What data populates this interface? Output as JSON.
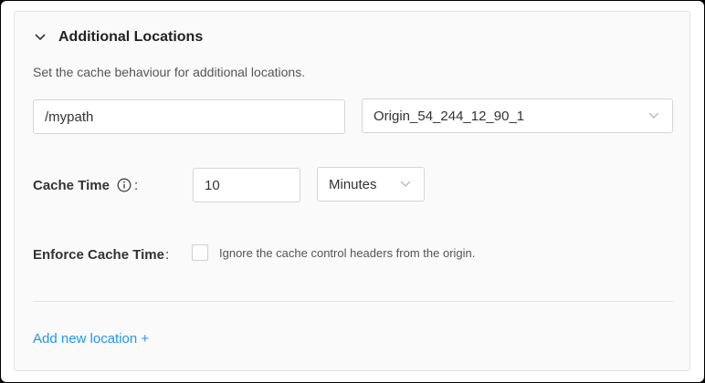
{
  "section": {
    "title": "Additional Locations",
    "description": "Set the cache behaviour for additional locations.",
    "collapse_icon": "chevron-down-icon"
  },
  "location": {
    "path_value": "/mypath",
    "origin_value": "Origin_54_244_12_90_1"
  },
  "cache_time": {
    "label": "Cache Time",
    "info_icon": "info-circle-icon",
    "colon": ":",
    "value": "10",
    "unit": "Minutes"
  },
  "enforce": {
    "label": "Enforce Cache Time",
    "colon": ":",
    "checked": false,
    "checkbox_text": "Ignore the cache control headers from the origin."
  },
  "actions": {
    "add_location": "Add new location +"
  },
  "colors": {
    "link": "#2196f3",
    "panel_bg": "#fafafa",
    "border": "#d5d5d5"
  }
}
